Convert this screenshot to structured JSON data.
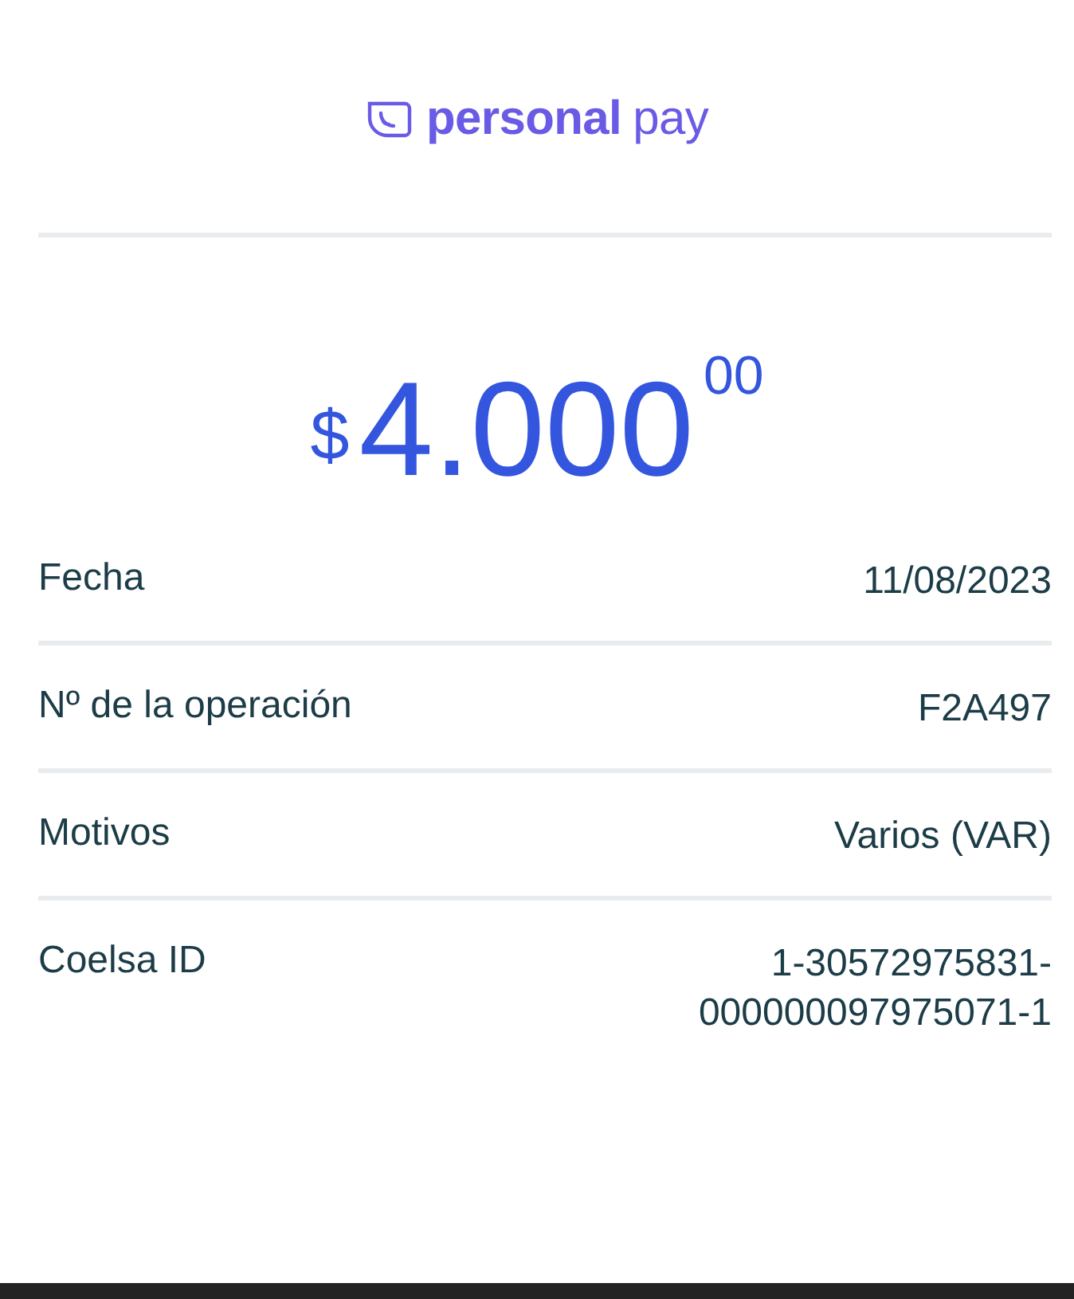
{
  "logo": {
    "brand": "personal",
    "suffix": "pay"
  },
  "amount": {
    "currency": "$",
    "whole": "4.000",
    "cents": "00"
  },
  "details": [
    {
      "label": "Fecha",
      "value": [
        "11/08/2023"
      ]
    },
    {
      "label": "Nº de la operación",
      "value": [
        "F2A497"
      ]
    },
    {
      "label": "Motivos",
      "value": [
        "Varios (VAR)"
      ]
    },
    {
      "label": "Coelsa ID",
      "value": [
        "1-30572975831-",
        "000000097975071-1"
      ]
    }
  ]
}
